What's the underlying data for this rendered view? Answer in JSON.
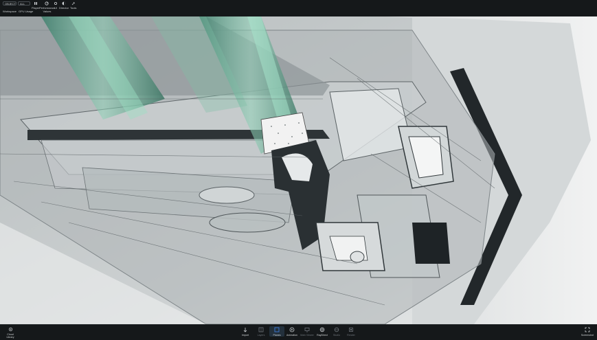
{
  "toolbar": {
    "selector_a": "OBJECT",
    "selector_b": "ALL",
    "items": [
      {
        "label": "Workspace"
      },
      {
        "label": "GPU Usage"
      },
      {
        "label": "Player"
      },
      {
        "label": "Performance",
        "sublabel": "Values"
      },
      {
        "label": "UI"
      },
      {
        "label": "Director"
      },
      {
        "label": "Tools"
      }
    ]
  },
  "bottombar": {
    "left": {
      "label": "Cloud",
      "sublabel": "Library"
    },
    "items": [
      {
        "label": "Import",
        "icon": "import-icon",
        "state": "normal"
      },
      {
        "label": "Layers",
        "icon": "layers-icon",
        "state": "dim"
      },
      {
        "label": "Planes",
        "icon": "planes-icon",
        "state": "active"
      },
      {
        "label": "Animation",
        "icon": "animation-icon",
        "state": "normal"
      },
      {
        "label": "Main Viewer",
        "icon": "viewer-icon",
        "state": "dim"
      },
      {
        "label": "RayDirect",
        "icon": "raydirect-icon",
        "state": "normal"
      },
      {
        "label": "Studio",
        "icon": "studio-icon",
        "state": "dim"
      },
      {
        "label": "Render",
        "icon": "render-icon",
        "state": "dim"
      }
    ],
    "right": {
      "label": "Screenshot",
      "icon": "screenshot-icon"
    }
  },
  "colors": {
    "bar_bg": "#15181a",
    "accent": "#3d7bd6",
    "glass": "#5fa98f",
    "aluminium": "#9aa1a4",
    "viewport_bg": "#c6cacb"
  }
}
